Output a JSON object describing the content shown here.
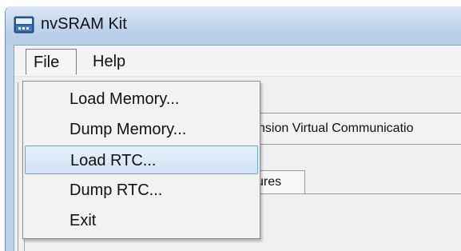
{
  "window": {
    "title": "nvSRAM Kit"
  },
  "menubar": {
    "items": [
      {
        "label": "File"
      },
      {
        "label": "Help"
      }
    ]
  },
  "file_menu": {
    "items": [
      {
        "label": "Load Memory..."
      },
      {
        "label": "Dump Memory..."
      },
      {
        "label": "Load RTC..."
      },
      {
        "label": "Dump RTC..."
      },
      {
        "label": "Exit"
      }
    ],
    "selected_label": "Load RTC..."
  },
  "background": {
    "tab_strip_text": "nsion Virtual Communicatio",
    "features_tab_text": "ures"
  },
  "colors": {
    "title_bar": "#bed3ea",
    "menu_highlight": "#d0e2f5",
    "highlight_border": "#6ea2d6"
  }
}
